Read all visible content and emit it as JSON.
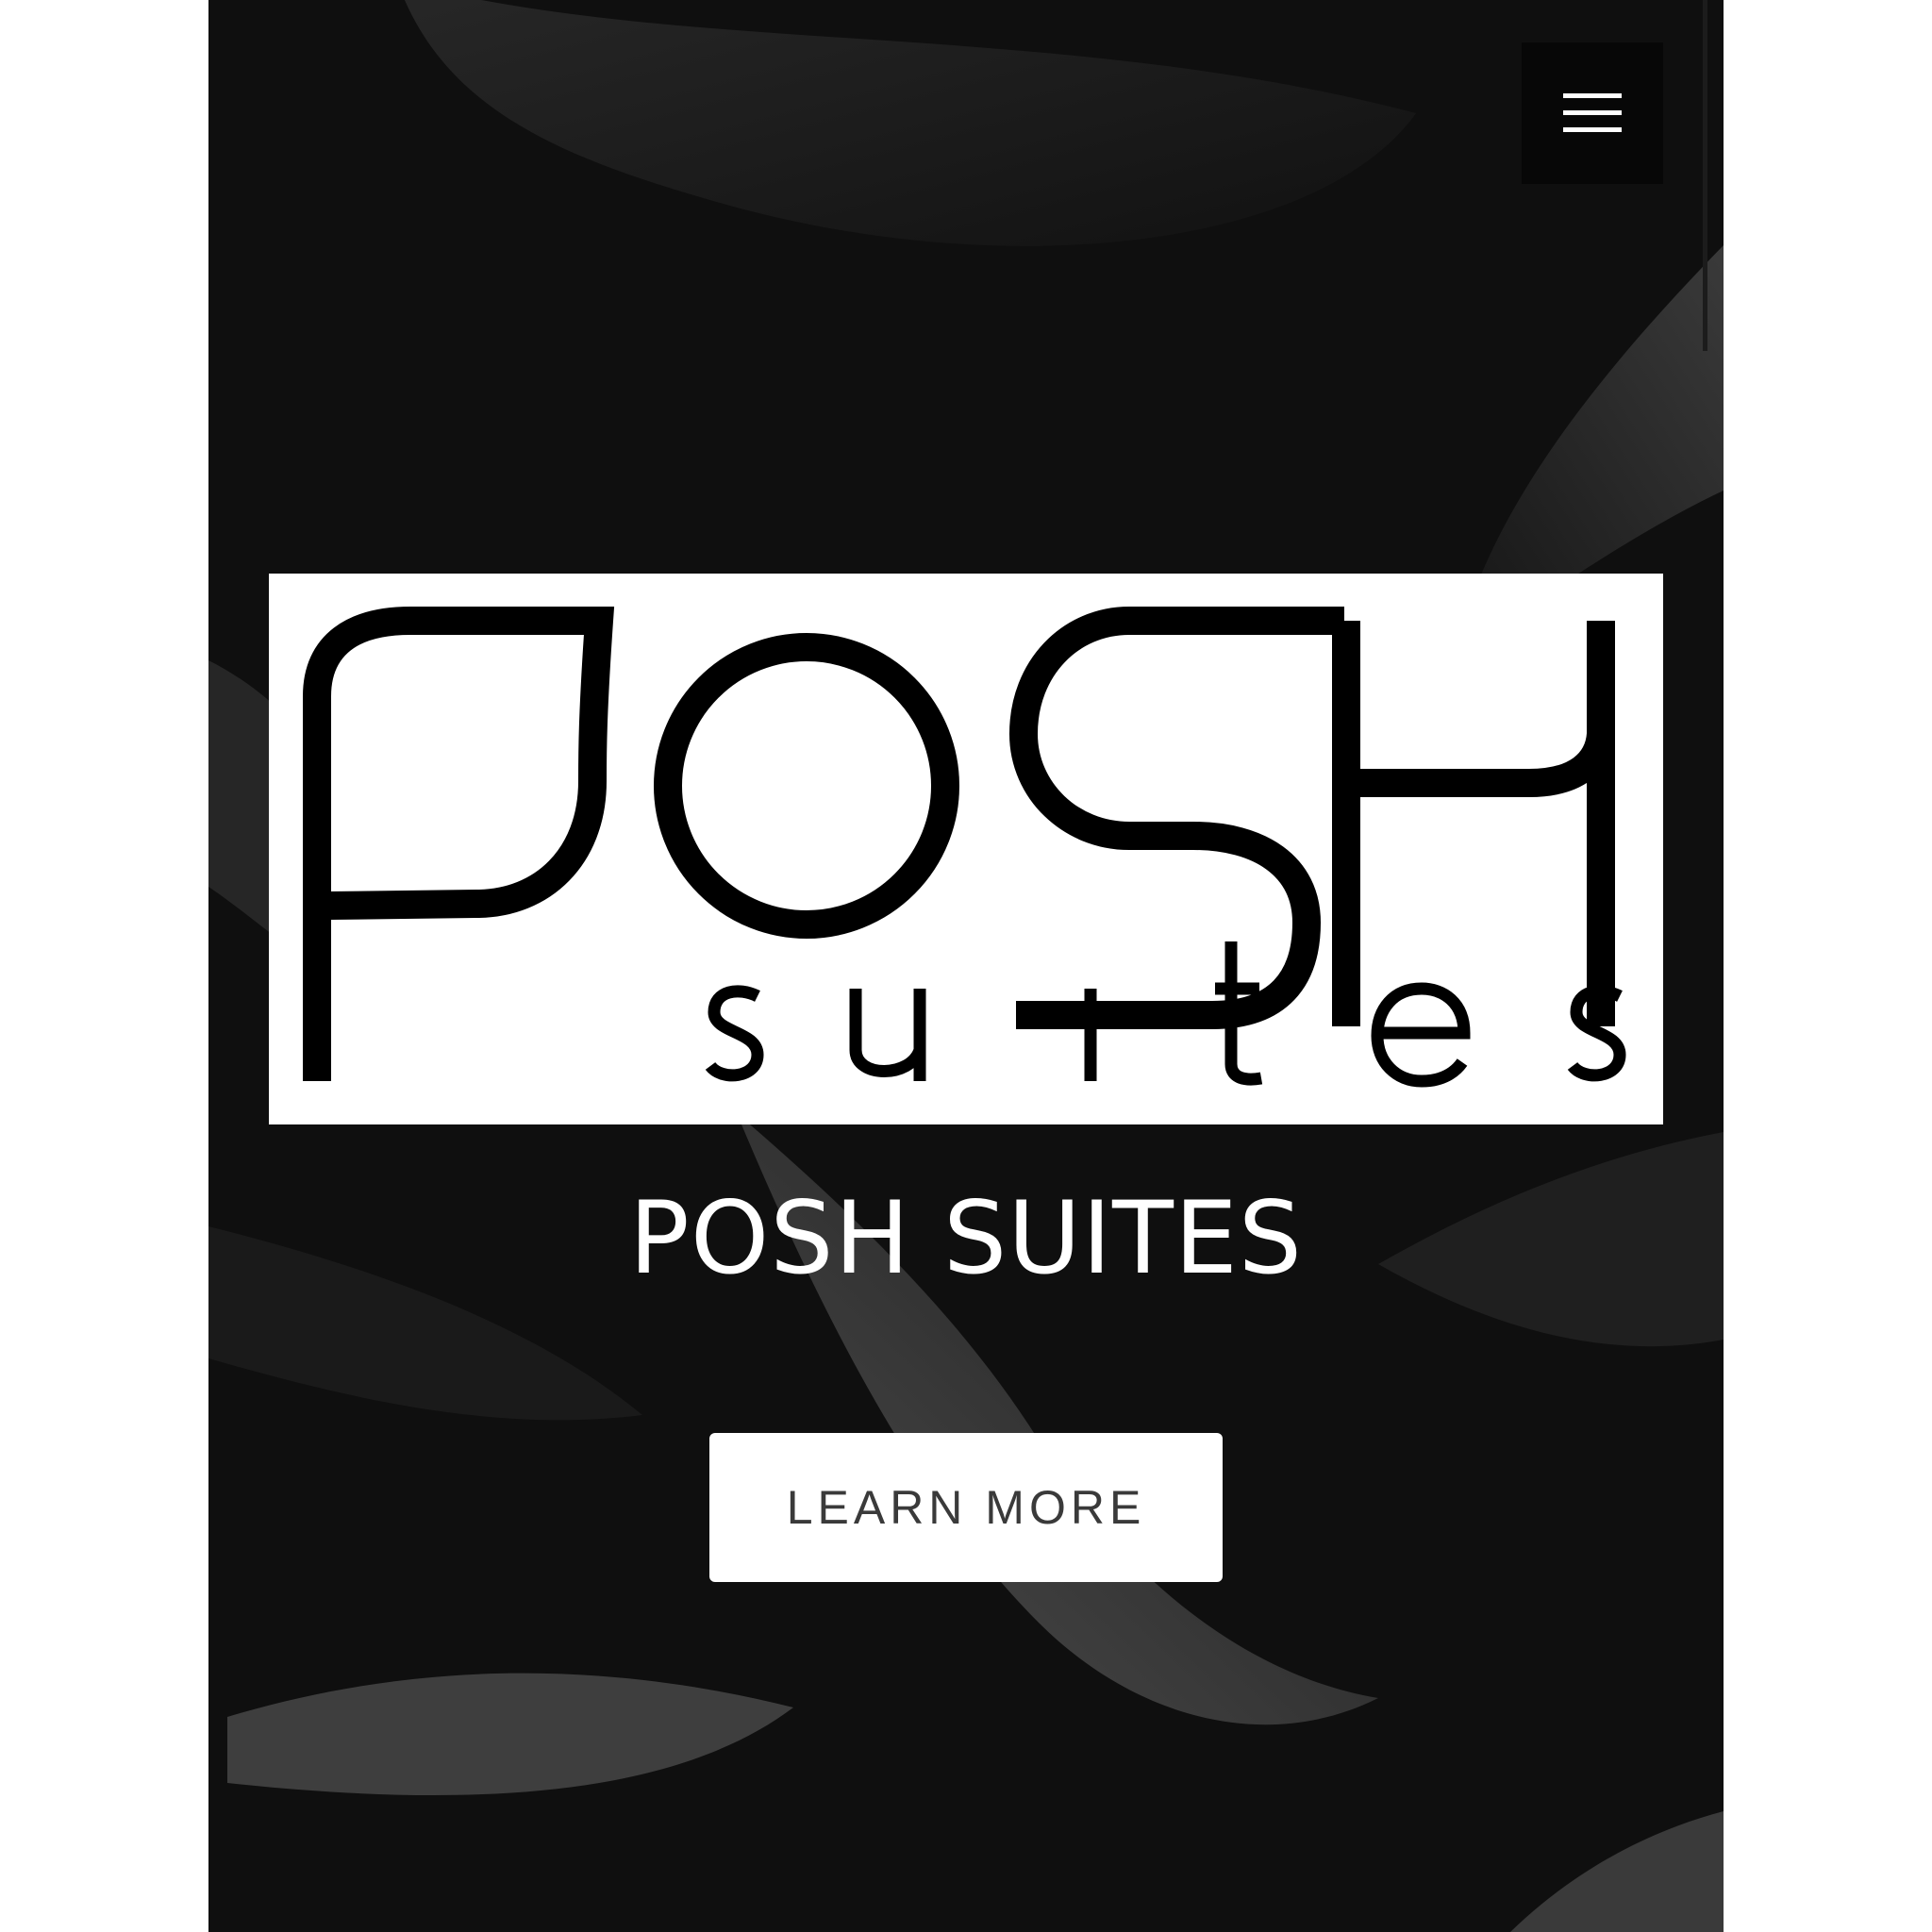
{
  "header": {
    "menu_icon": "hamburger-menu-icon"
  },
  "logo": {
    "wordmark": "POSH",
    "sub_wordmark": "suites"
  },
  "hero": {
    "title": "POSH SUITES",
    "cta_label": "LEARN MORE"
  },
  "colors": {
    "background": "#0e0e0e",
    "page_margin": "#ffffff",
    "text_on_dark": "#ffffff",
    "button_bg": "#ffffff",
    "button_text": "#3a3a3a"
  }
}
